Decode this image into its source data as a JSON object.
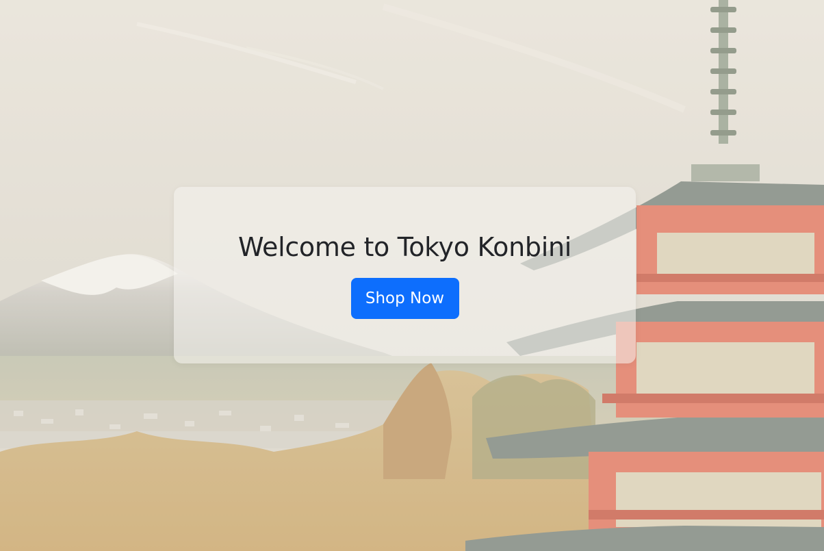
{
  "hero": {
    "title": "Welcome to Tokyo Konbini",
    "cta_label": "Shop Now"
  },
  "colors": {
    "primary_button": "#0d6efd",
    "title_text": "#222428",
    "pagoda_red": "#e06a52"
  },
  "background": {
    "scene": "landscape-with-mountain-and-pagoda"
  }
}
